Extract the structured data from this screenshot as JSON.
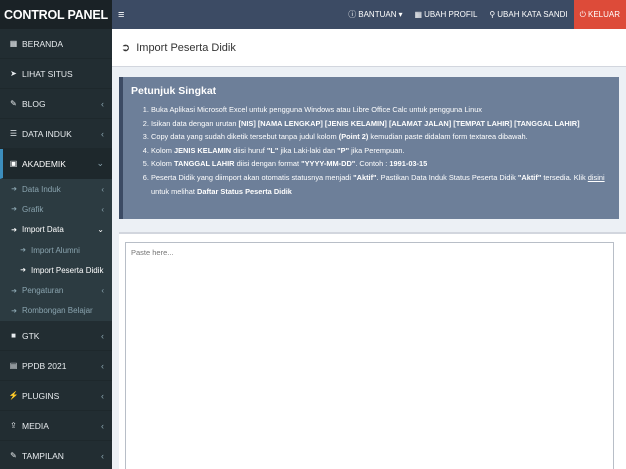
{
  "brand": "CONTROL PANEL",
  "navbar": {
    "menu_toggle": "≡",
    "links": [
      {
        "label": "BANTUAN",
        "icon": "question-icon",
        "caret": "▾"
      },
      {
        "label": "UBAH PROFIL",
        "icon": "id-card-icon"
      },
      {
        "label": "UBAH KATA SANDI",
        "icon": "key-icon"
      },
      {
        "label": "KELUAR",
        "icon": "power-icon"
      }
    ]
  },
  "sidebar": {
    "items": [
      {
        "label": "BERANDA",
        "icon": "dashboard-icon"
      },
      {
        "label": "LIHAT SITUS",
        "icon": "rocket-icon"
      },
      {
        "label": "BLOG",
        "icon": "edit-icon"
      },
      {
        "label": "DATA INDUK",
        "icon": "list-icon"
      },
      {
        "label": "AKADEMIK",
        "icon": "book-icon"
      },
      {
        "label": "GTK",
        "icon": "cube-icon"
      },
      {
        "label": "PPDB 2021",
        "icon": "file-icon"
      },
      {
        "label": "PLUGINS",
        "icon": "plug-icon"
      },
      {
        "label": "MEDIA",
        "icon": "upload-icon"
      },
      {
        "label": "TAMPILAN",
        "icon": "paint-icon"
      }
    ],
    "akademik_sub": [
      {
        "label": "Data Induk"
      },
      {
        "label": "Grafik"
      },
      {
        "label": "Import Data"
      },
      {
        "label": "Import Alumni"
      },
      {
        "label": "Import Peserta Didik"
      },
      {
        "label": "Pengaturan"
      },
      {
        "label": "Rombongan Belajar"
      }
    ]
  },
  "page": {
    "title": "Import Peserta Didik"
  },
  "callout": {
    "title": "Petunjuk Singkat",
    "steps": {
      "s1": "Buka Aplikasi Microsoft Excel untuk pengguna Windows atau Libre Office Calc untuk pengguna Linux",
      "s2_pre": "Isikan data dengan urutan ",
      "s2_bold": "[NIS] [NAMA LENGKAP] [JENIS KELAMIN] [ALAMAT JALAN] [TEMPAT LAHIR] [TANGGAL LAHIR]",
      "s3_pre": "Copy data yang sudah diketik tersebut tanpa judul kolom ",
      "s3_bold": "(Point 2)",
      "s3_post": " kemudian paste didalam form textarea dibawah.",
      "s4_a": "Kolom ",
      "s4_b": "JENIS KELAMIN",
      "s4_c": " diisi huruf ",
      "s4_d": "\"L\"",
      "s4_e": " jika Laki-laki dan ",
      "s4_f": "\"P\"",
      "s4_g": " jika Perempuan.",
      "s5_a": "Kolom ",
      "s5_b": "TANGGAL LAHIR",
      "s5_c": " diisi dengan format ",
      "s5_d": "\"YYYY-MM-DD\"",
      "s5_e": ". Contoh : ",
      "s5_f": "1991-03-15",
      "s6_a": "Peserta Didik yang diimport akan otomatis statusnya menjadi ",
      "s6_b": "\"Aktif\"",
      "s6_c": ". Pastikan Data Induk Status Peserta Didik ",
      "s6_d": "\"Aktif\"",
      "s6_e": " tersedia. Klik ",
      "s6_f": "disini",
      "s6_g": " untuk melihat ",
      "s6_h": "Daftar Status Peserta Didik"
    }
  },
  "form": {
    "placeholder": "Paste here..."
  }
}
